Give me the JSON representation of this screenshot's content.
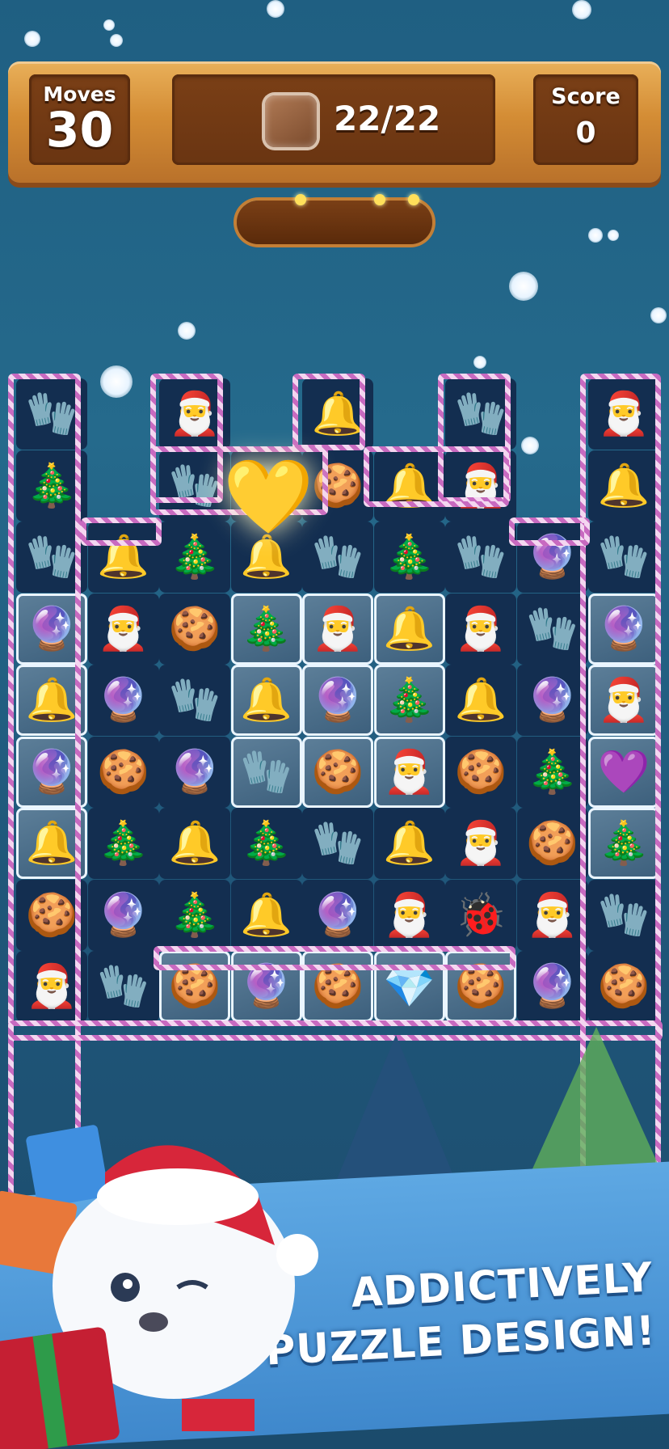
{
  "hud": {
    "moves_label": "Moves",
    "moves_value": "30",
    "goal_count": "22/22",
    "score_label": "Score",
    "score_value": "0"
  },
  "board": {
    "rows": [
      [
        "mitten",
        "",
        "santa-hat",
        "",
        "bell",
        "",
        "mitten",
        "",
        "santa-hat"
      ],
      [
        "tree",
        "",
        "mitten",
        "heart",
        "gingerbread",
        "bell",
        "santa-hat",
        "",
        "bell"
      ],
      [
        "mitten",
        "bell",
        "tree",
        "bell",
        "mitten",
        "tree",
        "mitten",
        "ornament",
        "mitten"
      ],
      [
        "ornament",
        "santa-hat",
        "gingerbread",
        "tree",
        "santa-hat",
        "bell",
        "santa-hat",
        "mitten",
        "ornament"
      ],
      [
        "bell",
        "ornament",
        "mitten",
        "bell",
        "ornament",
        "tree",
        "bell",
        "ornament",
        "santa-hat"
      ],
      [
        "ornament",
        "gingerbread",
        "ornament",
        "mitten",
        "gingerbread",
        "santa-hat",
        "gingerbread",
        "tree",
        "gem"
      ],
      [
        "bell",
        "tree",
        "bell",
        "tree",
        "mitten",
        "bell",
        "santa-hat",
        "gingerbread",
        "tree"
      ],
      [
        "gingerbread",
        "ornament",
        "tree",
        "bell",
        "ornament",
        "santa-hat",
        "ladybug",
        "santa-hat",
        "mitten"
      ],
      [
        "santa-hat",
        "mitten",
        "gingerbread",
        "ornament",
        "gingerbread",
        "crystal-block",
        "gingerbread",
        "ornament",
        "gingerbread"
      ]
    ]
  },
  "icons": {
    "mitten": "🧤",
    "santa-hat": "🎅",
    "bell": "🔔",
    "tree": "🎄",
    "gingerbread": "🍪",
    "ornament": "🔮",
    "heart": "💛",
    "gem": "💜",
    "ladybug": "🐞",
    "crystal-block": "💎"
  },
  "banner": {
    "line1": "ADDICTIVELY",
    "line2": "PUZZLE DESIGN!"
  }
}
